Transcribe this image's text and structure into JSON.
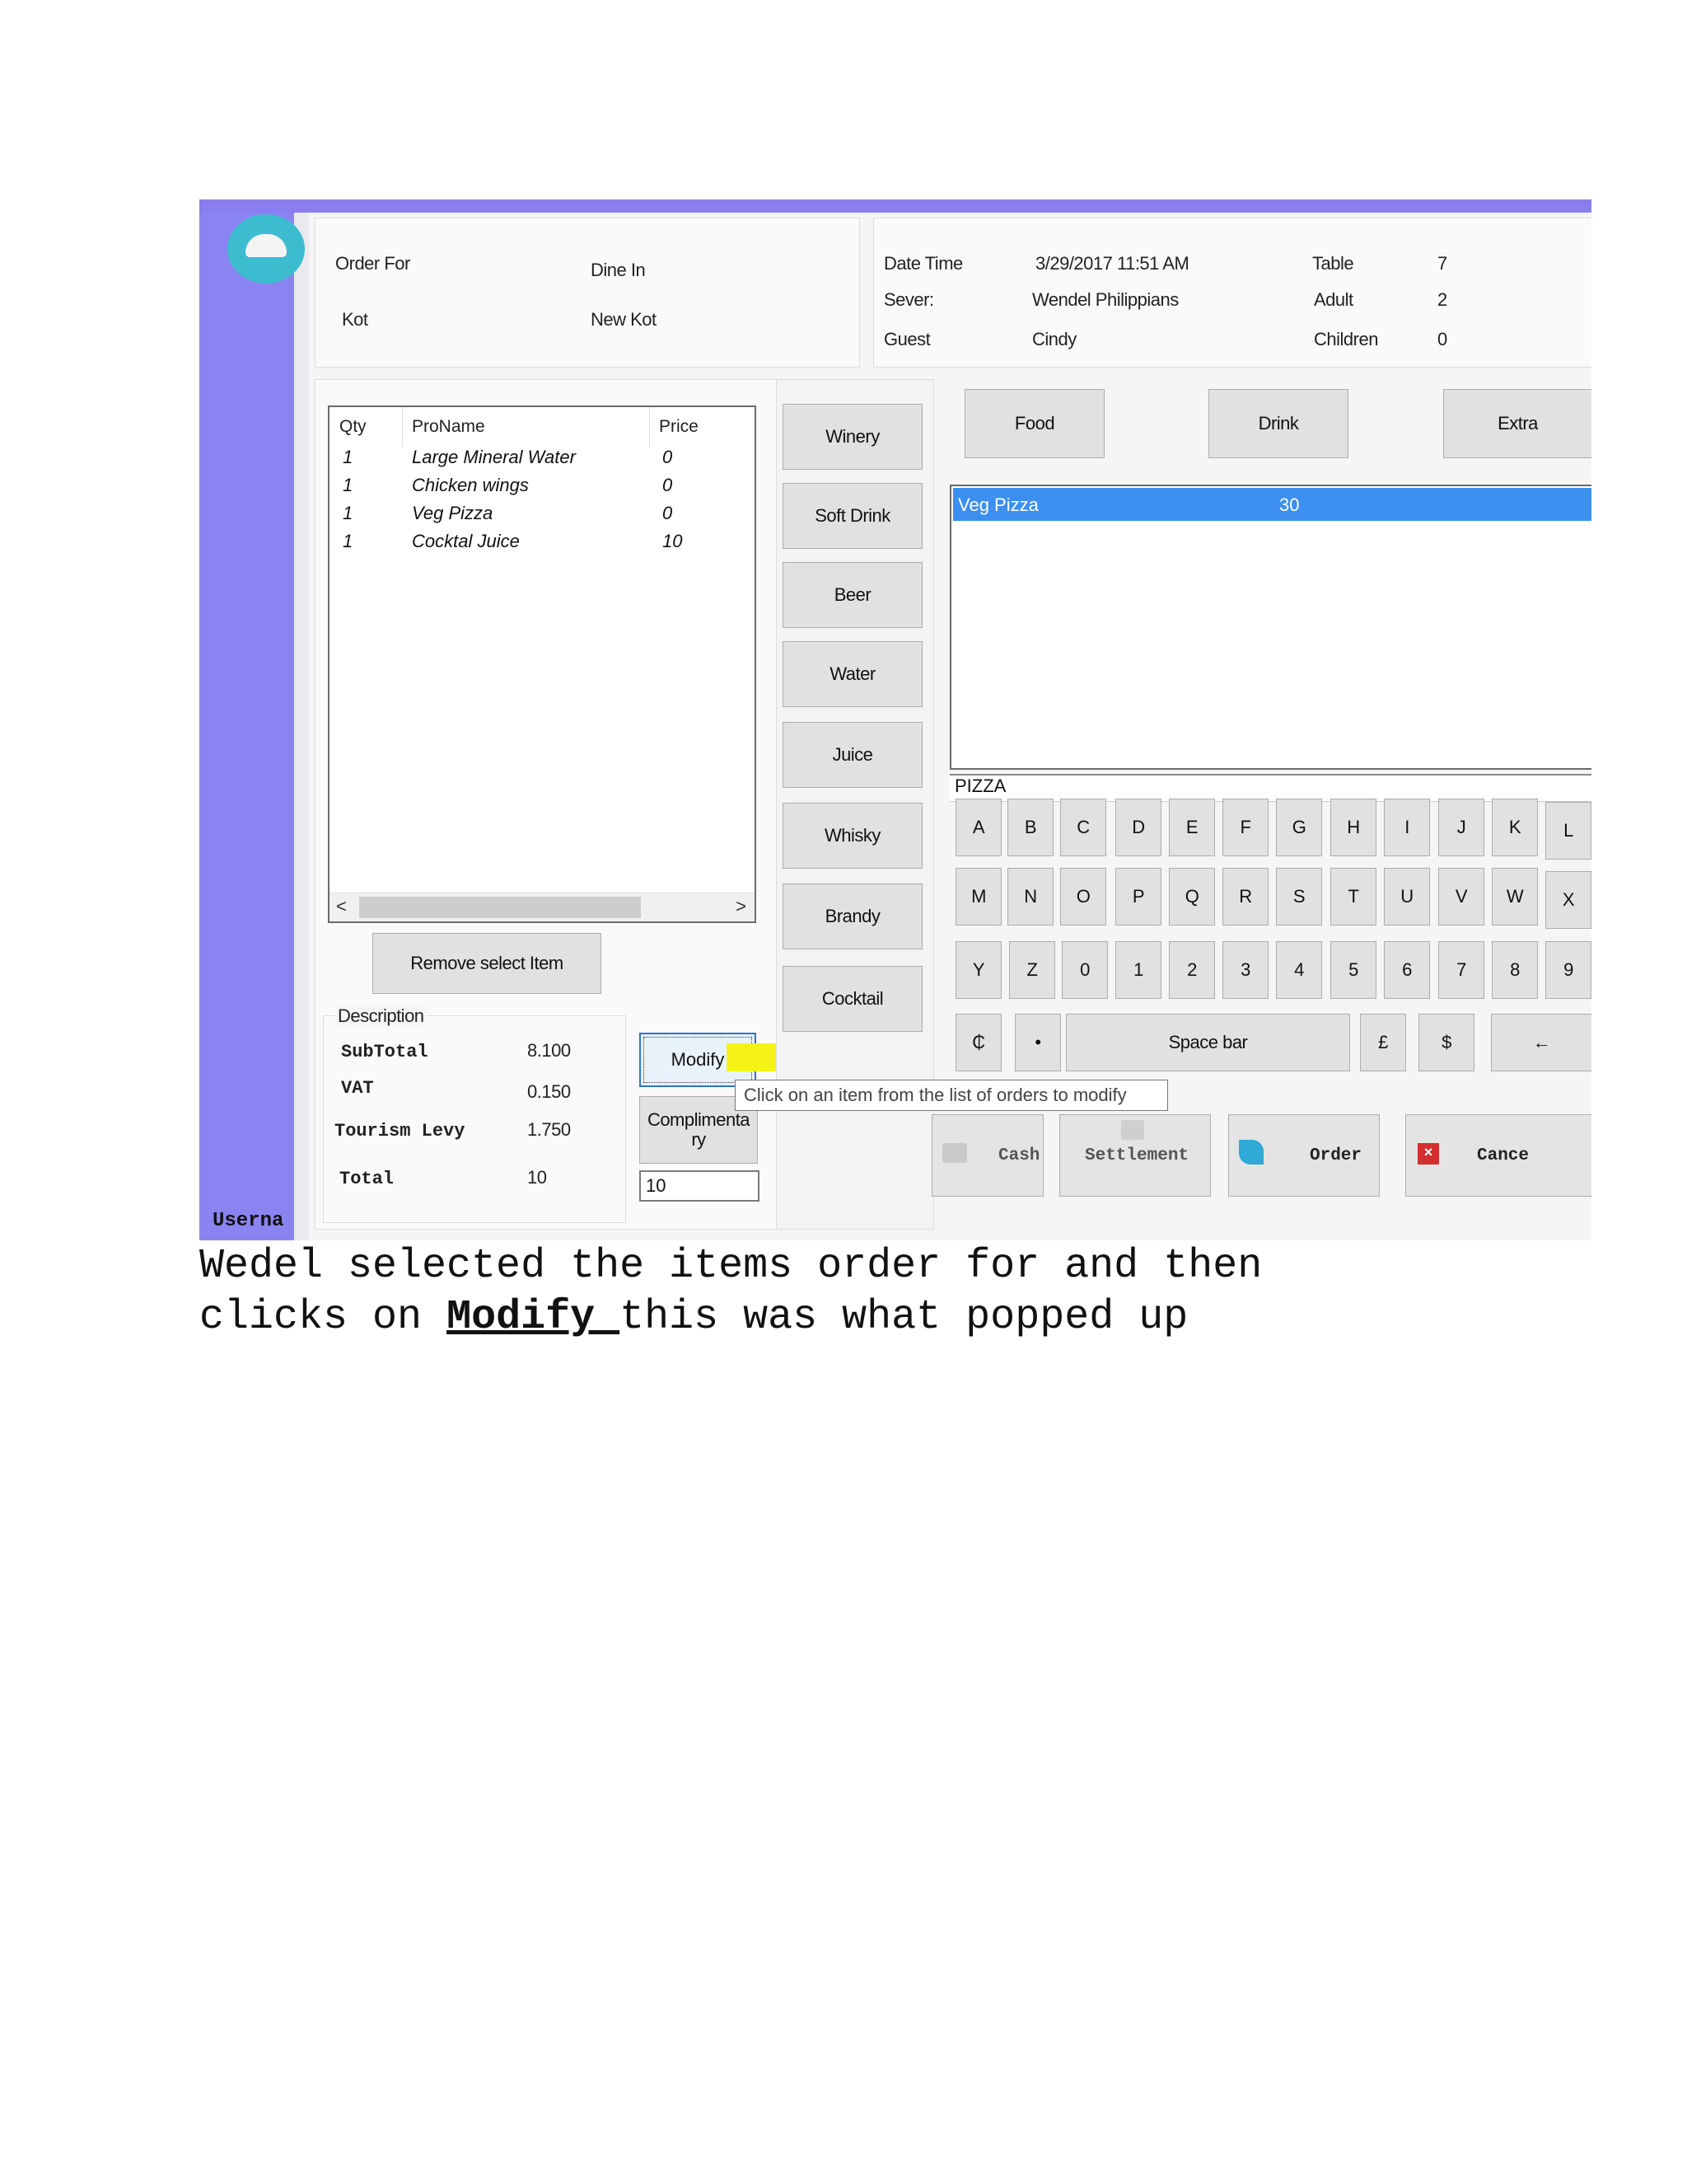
{
  "header": {
    "order_for_label": "Order For",
    "order_for_value": "Dine In",
    "kot_label": "Kot",
    "kot_value": "New Kot",
    "datetime_label": "Date Time",
    "datetime_value": "3/29/2017 11:51 AM",
    "server_label": "Sever:",
    "server_value": "Wendel Philippians",
    "guest_label": "Guest",
    "guest_value": "Cindy",
    "table_label": "Table",
    "table_value": "7",
    "adult_label": "Adult",
    "adult_value": "2",
    "children_label": "Children",
    "children_value": "0"
  },
  "order_grid": {
    "headers": [
      "Qty",
      "ProName",
      "Price"
    ],
    "rows": [
      {
        "qty": "1",
        "name": "Large Mineral Water",
        "price": "0"
      },
      {
        "qty": "1",
        "name": "Chicken wings",
        "price": "0"
      },
      {
        "qty": "1",
        "name": "Veg Pizza",
        "price": "0"
      },
      {
        "qty": "1",
        "name": "Cocktal Juice",
        "price": "10"
      }
    ],
    "scroll_left": "<",
    "scroll_right": ">"
  },
  "remove_button": "Remove select Item",
  "totals": {
    "description_label": "Description",
    "subtotal_label": "SubTotal",
    "subtotal_value": "8.100",
    "vat_label": "VAT",
    "vat_value": "0.150",
    "levy_label": "Tourism Levy",
    "levy_value": "1.750",
    "total_label": "Total",
    "total_value": "10"
  },
  "modify_button": "Modify",
  "complimentary_button_line1": "Complimenta",
  "complimentary_button_line2": "ry",
  "complimentary_input": "10",
  "tooltip": "Click on an item from the list of orders to modify",
  "categories": [
    "Winery",
    "Soft Drink",
    "Beer",
    "Water",
    "Juice",
    "Whisky",
    "Brandy",
    "Cocktail"
  ],
  "tabs": [
    "Food",
    "Drink",
    "Extra"
  ],
  "product_list": {
    "selected_name": "Veg Pizza",
    "selected_price": "30"
  },
  "search_text": "PIZZA",
  "keyboard": {
    "row1": [
      "A",
      "B",
      "C",
      "D",
      "E",
      "F",
      "G",
      "H",
      "I",
      "J",
      "K",
      "L"
    ],
    "row2": [
      "M",
      "N",
      "O",
      "P",
      "Q",
      "R",
      "S",
      "T",
      "U",
      "V",
      "W",
      "X"
    ],
    "row3": [
      "Y",
      "Z",
      "0",
      "1",
      "2",
      "3",
      "4",
      "5",
      "6",
      "7",
      "8",
      "9"
    ],
    "cedi": "₵",
    "dot": "•",
    "space": "Space bar",
    "pound": "£",
    "dollar": "$",
    "backspace": "←"
  },
  "actions": {
    "cash": "Cash",
    "settlement": "Settlement",
    "order": "Order",
    "cancel": "Cance"
  },
  "username_label": "Userna",
  "caption": {
    "line1": "Wedel selected the items order for and then",
    "line2_pre": "clicks on ",
    "line2_bold": "Modify ",
    "line2_post": "this was what popped up"
  },
  "colors": {
    "sidebar": "#8a84f2",
    "selection": "#3d8ff0",
    "highlight": "#f5f21a",
    "logo": "#3dbcd0"
  }
}
